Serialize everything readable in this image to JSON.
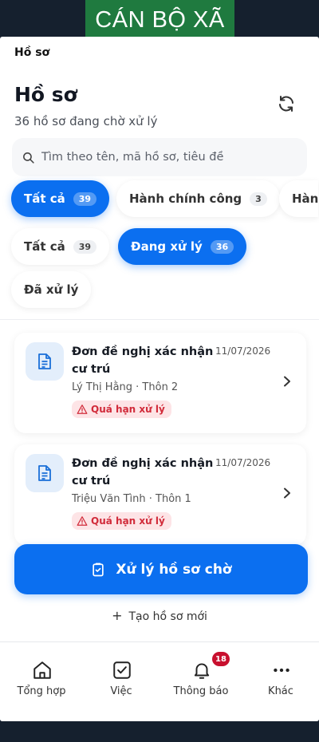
{
  "banner": {
    "text": "CÁN BỘ XÃ"
  },
  "topbar": {
    "title": "Hồ sơ"
  },
  "header": {
    "title": "Hồ sơ",
    "subtitle": "36 hồ sơ đang chờ xử lý",
    "refresh_icon": "refresh-icon"
  },
  "search": {
    "placeholder": "Tìm theo tên, mã hồ sơ, tiêu đề",
    "value": ""
  },
  "category_chips": [
    {
      "label": "Tất cả",
      "count": "39",
      "active": true
    },
    {
      "label": "Hành chính công",
      "count": "3",
      "active": false
    },
    {
      "label": "Hàn",
      "count": "",
      "active": false
    }
  ],
  "status_chips": [
    {
      "label": "Tất cả",
      "count": "39",
      "active": false
    },
    {
      "label": "Đang xử lý",
      "count": "36",
      "active": true
    },
    {
      "label": "Đã xử lý",
      "count": "",
      "active": false
    }
  ],
  "records": [
    {
      "title": "Đơn đề nghị xác nhận cư trú",
      "date": "11/07/2026",
      "meta": "Lý Thị Hằng · Thôn 2",
      "badge": "Quá hạn xử lý"
    },
    {
      "title": "Đơn đề nghị xác nhận cư trú",
      "date": "11/07/2026",
      "meta": "Triệu Văn Tình · Thôn 1",
      "badge": "Quá hạn xử lý"
    }
  ],
  "actions": {
    "primary_label": "Xử lý hồ sơ chờ",
    "secondary_label": "Tạo hồ sơ mới"
  },
  "tabbar": {
    "items": [
      {
        "label": "Tổng hợp",
        "icon": "home-icon"
      },
      {
        "label": "Việc",
        "icon": "checkbox-icon"
      },
      {
        "label": "Thông báo",
        "icon": "bell-icon",
        "badge": "18"
      },
      {
        "label": "Khác",
        "icon": "more-icon"
      }
    ]
  },
  "colors": {
    "accent": "#0b6ff0",
    "banner": "#1f7a3f",
    "danger": "#d12b3a",
    "badge_bg": "#fde4e6"
  }
}
